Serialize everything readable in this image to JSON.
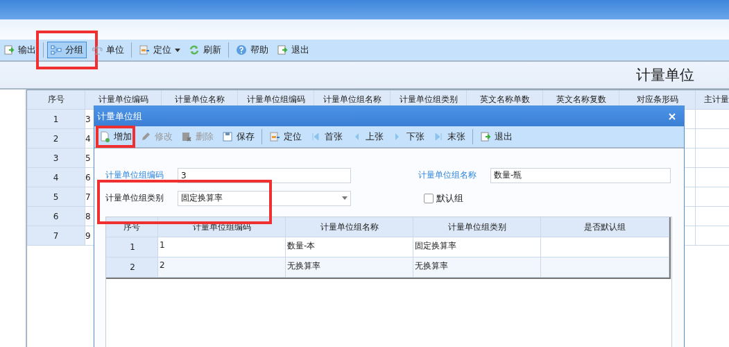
{
  "toolbar": [
    {
      "kind": "button",
      "label": "输出",
      "selected": false,
      "highlighted": false,
      "dropdown": false
    },
    {
      "kind": "separator"
    },
    {
      "kind": "button",
      "label": "分组",
      "selected": true,
      "highlighted": true,
      "dropdown": false
    },
    {
      "kind": "button",
      "label": "单位",
      "selected": false,
      "highlighted": false,
      "dropdown": false
    },
    {
      "kind": "separator"
    },
    {
      "kind": "button",
      "label": "定位",
      "selected": false,
      "highlighted": false,
      "dropdown": true
    },
    {
      "kind": "button",
      "label": "刷新",
      "selected": false,
      "highlighted": false,
      "dropdown": false
    },
    {
      "kind": "separator"
    },
    {
      "kind": "button",
      "label": "帮助",
      "selected": false,
      "highlighted": false,
      "dropdown": false
    },
    {
      "kind": "button",
      "label": "退出",
      "selected": false,
      "highlighted": false,
      "dropdown": false
    }
  ],
  "page_title": "计量单位",
  "grid": {
    "columns": [
      "序号",
      "计量单位编码",
      "计量单位名称",
      "计量单位组编码",
      "计量单位组名称",
      "计量单位组类别",
      "英文名称单数",
      "英文名称复数",
      "对应条形码",
      "主计量"
    ],
    "rows": [
      {
        "index": "1",
        "code": "3"
      },
      {
        "index": "2",
        "code": "4"
      },
      {
        "index": "3",
        "code": "5"
      },
      {
        "index": "4",
        "code": "6"
      },
      {
        "index": "5",
        "code": "7"
      },
      {
        "index": "6",
        "code": "8"
      },
      {
        "index": "7",
        "code": "9"
      }
    ]
  },
  "dialog": {
    "title": "计量单位组",
    "toolbar": [
      {
        "kind": "button",
        "label": "增加",
        "disabled": false,
        "highlighted": true
      },
      {
        "kind": "button",
        "label": "修改",
        "disabled": true,
        "highlighted": false
      },
      {
        "kind": "button",
        "label": "删除",
        "disabled": true,
        "highlighted": false
      },
      {
        "kind": "button",
        "label": "保存",
        "disabled": false,
        "highlighted": false
      },
      {
        "kind": "separator"
      },
      {
        "kind": "button",
        "label": "定位",
        "disabled": false,
        "highlighted": false
      },
      {
        "kind": "button",
        "label": "首张",
        "disabled": false,
        "highlighted": false
      },
      {
        "kind": "button",
        "label": "上张",
        "disabled": false,
        "highlighted": false
      },
      {
        "kind": "button",
        "label": "下张",
        "disabled": false,
        "highlighted": false
      },
      {
        "kind": "button",
        "label": "末张",
        "disabled": false,
        "highlighted": false
      },
      {
        "kind": "separator"
      },
      {
        "kind": "button",
        "label": "退出",
        "disabled": false,
        "highlighted": false
      }
    ],
    "code_field": {
      "label": "计量单位组编码",
      "value": "3"
    },
    "name_field": {
      "label": "计量单位组名称",
      "value": "数量-瓶"
    },
    "type_field": {
      "label": "计量单位组类别",
      "value": "固定换算率",
      "highlighted": true
    },
    "default_group": {
      "label": "默认组",
      "checked": false
    },
    "table": {
      "columns": [
        "序号",
        "计量单位组编码",
        "计量单位组名称",
        "计量单位组类别",
        "是否默认组"
      ],
      "rows": [
        {
          "cells": [
            "1",
            "1",
            "数量-本",
            "固定换算率",
            ""
          ]
        },
        {
          "cells": [
            "2",
            "2",
            "无换算率",
            "无换算率",
            ""
          ]
        }
      ]
    }
  }
}
